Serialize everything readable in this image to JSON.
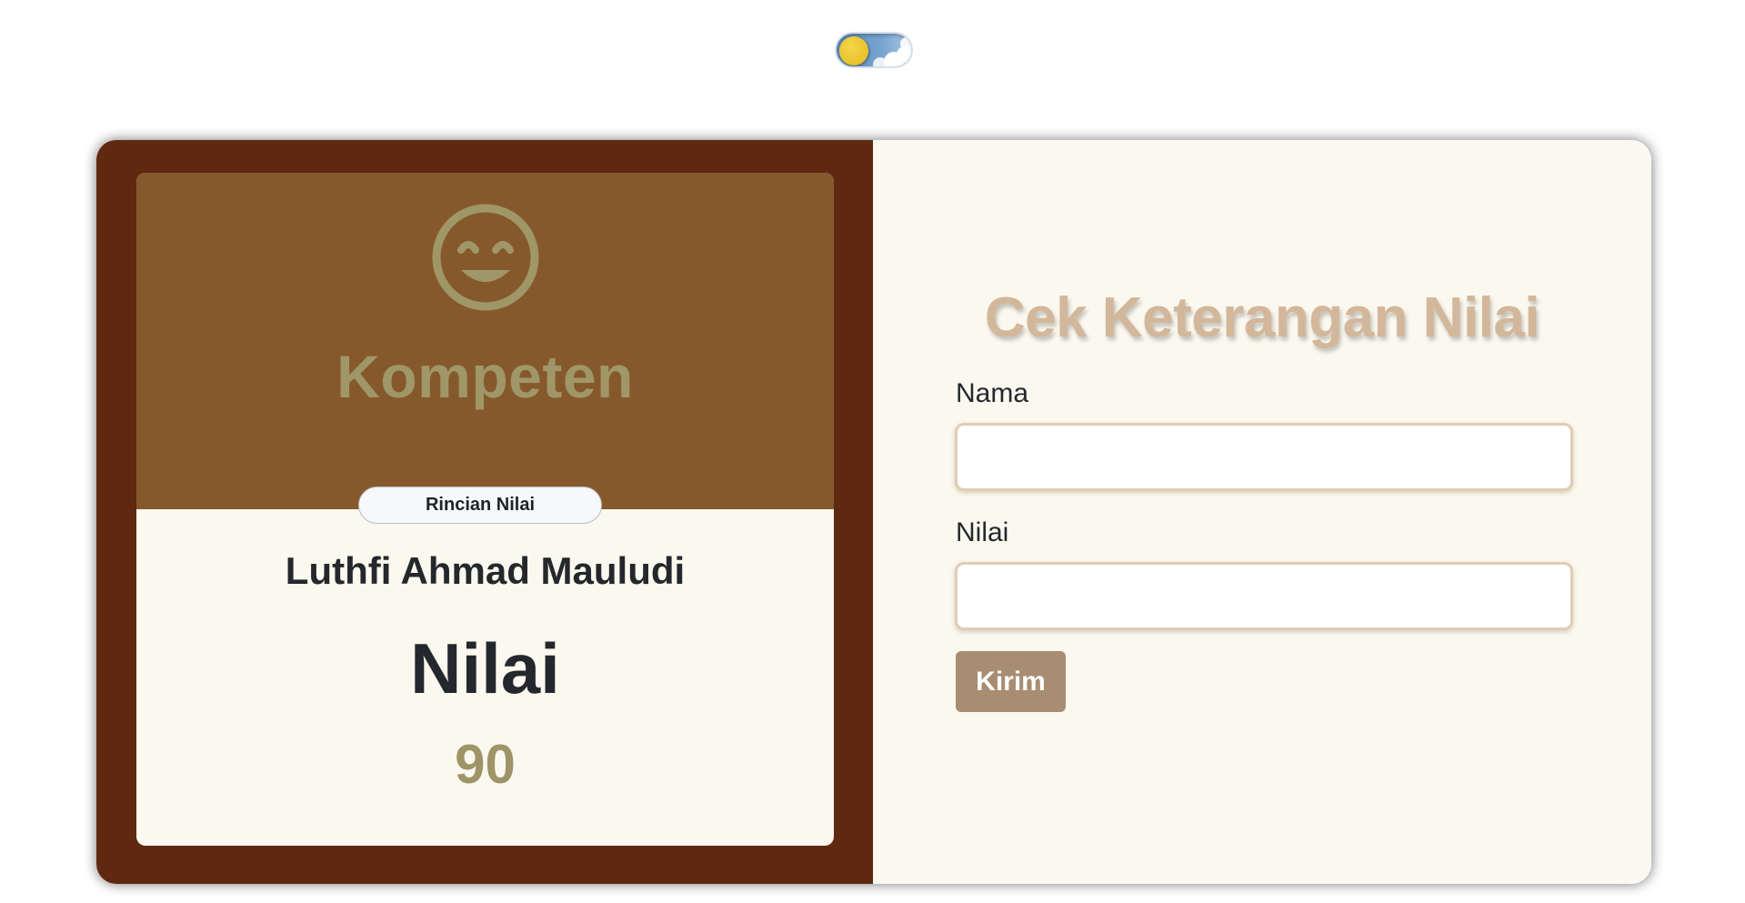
{
  "theme_toggle": {
    "icon": "sun-cloud-toggle",
    "state": "light"
  },
  "result_card": {
    "status_icon": "smiley-icon",
    "status_title": "Kompeten",
    "detail_badge": "Rincian Nilai",
    "student_name": "Luthfi Ahmad Mauludi",
    "score_label": "Nilai",
    "score_value": "90"
  },
  "form": {
    "title": "Cek Keterangan Nilai",
    "name_label": "Nama",
    "name_value": "",
    "score_label": "Nilai",
    "score_value": "",
    "submit_label": "Kirim"
  },
  "colors": {
    "left_panel": "#5f2811",
    "result_header": "#86592d",
    "accent_olive": "#a09768",
    "title_tan": "#d3b79a",
    "button": "#a88d72",
    "background_cream": "#fbf8ef"
  }
}
